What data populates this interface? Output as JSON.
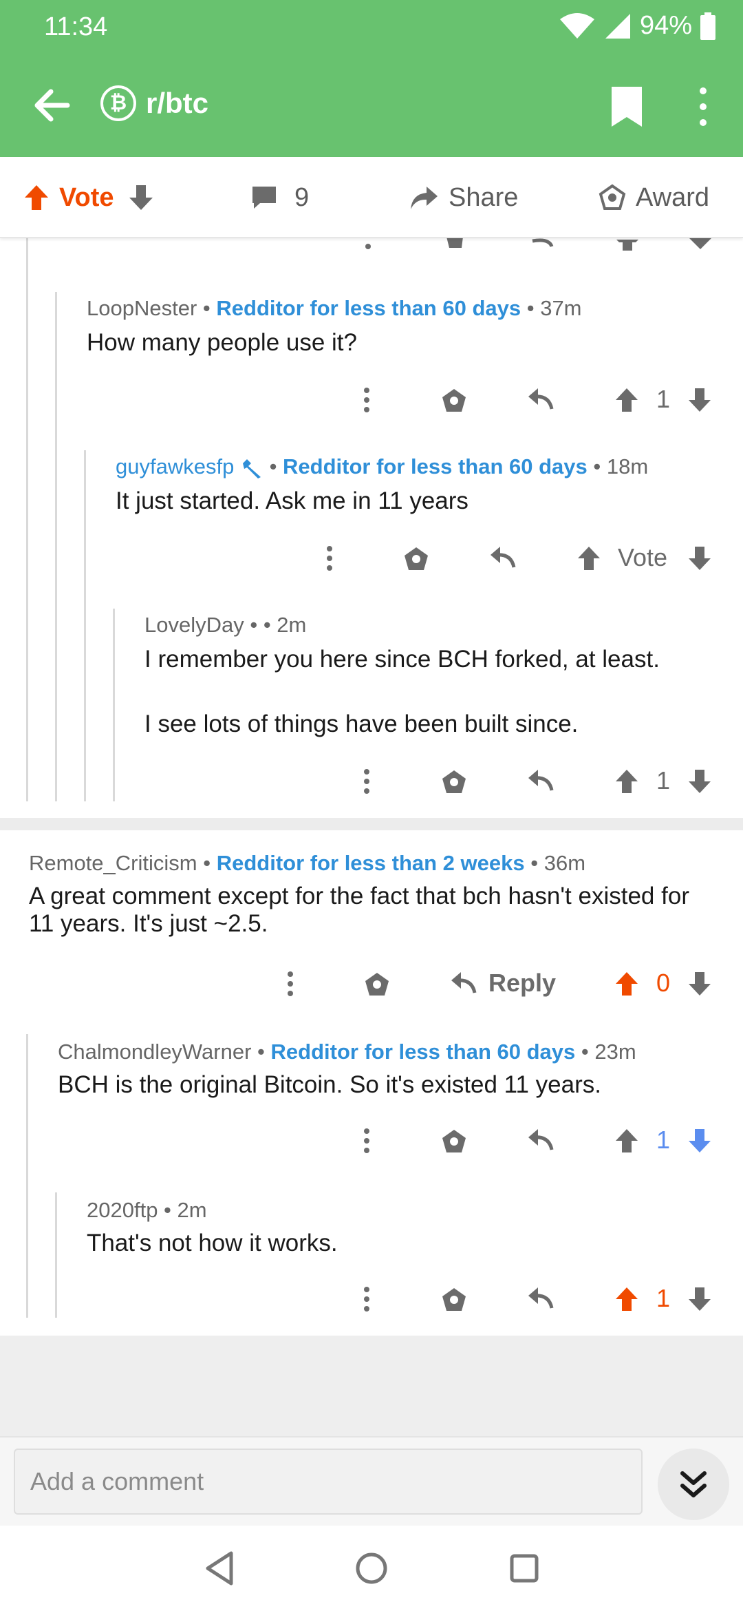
{
  "status_bar": {
    "time": "11:34",
    "battery": "94%"
  },
  "toolbar": {
    "subreddit": "r/btc",
    "sub_icon": "bitcoin-icon"
  },
  "post_actions": {
    "vote": "Vote",
    "comment_count": "9",
    "share": "Share",
    "award": "Award"
  },
  "comments": [
    {
      "user": "LoopNester",
      "flair": "Redditor for less than 60 days",
      "age": "37m",
      "text": "How many people use it?",
      "score": "1"
    },
    {
      "user": "guyfawkesfp",
      "flair": "Redditor for less than 60 days",
      "age": "18m",
      "text": "It just started. Ask me in 11 years",
      "score": "Vote"
    },
    {
      "user": "LovelyDay",
      "age": "2m",
      "text1": "I remember you here since BCH forked, at least.",
      "text2": "I see lots of things have been built since.",
      "score": "1"
    },
    {
      "user": "Remote_Criticism",
      "flair": "Redditor for less than 2 weeks",
      "age": "36m",
      "text": "A great comment except for the fact that bch hasn't existed for 11 years.  It's just ~2.5.",
      "reply": "Reply",
      "score": "0"
    },
    {
      "user": "ChalmondleyWarner",
      "flair": "Redditor for less than 60 days",
      "age": "23m",
      "text": "BCH is the original Bitcoin. So it's existed 11 years.",
      "score": "1"
    },
    {
      "user": "2020ftp",
      "age": "2m",
      "text": "That's not how it works.",
      "score": "1"
    }
  ],
  "composer": {
    "placeholder": "Add a comment"
  },
  "colors": {
    "header": "#68c26f",
    "upvote": "#f04a00",
    "downvote": "#5b8def",
    "flair": "#2f8fd8"
  }
}
